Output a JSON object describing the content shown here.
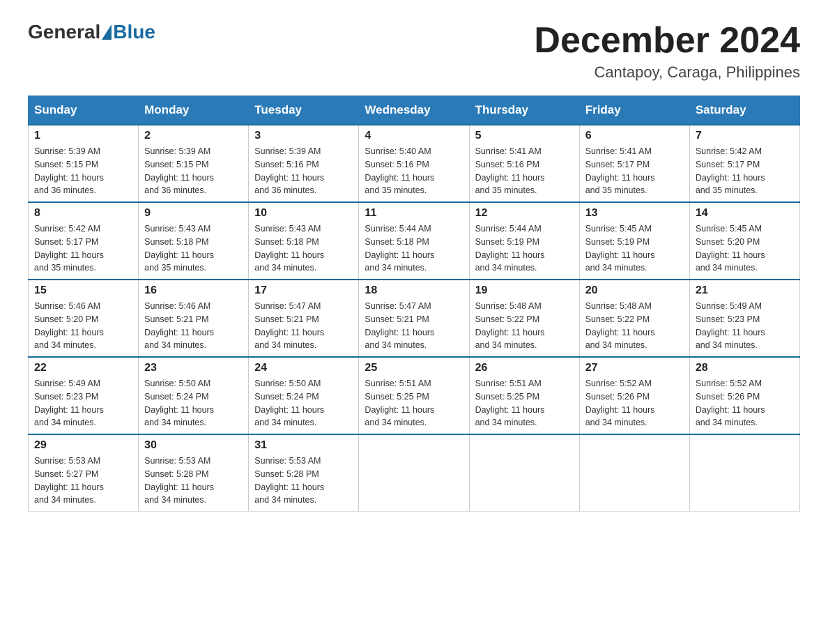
{
  "logo": {
    "general": "General",
    "blue": "Blue"
  },
  "title": "December 2024",
  "location": "Cantapoy, Caraga, Philippines",
  "headers": [
    "Sunday",
    "Monday",
    "Tuesday",
    "Wednesday",
    "Thursday",
    "Friday",
    "Saturday"
  ],
  "weeks": [
    [
      {
        "day": "1",
        "sunrise": "5:39 AM",
        "sunset": "5:15 PM",
        "daylight": "11 hours and 36 minutes."
      },
      {
        "day": "2",
        "sunrise": "5:39 AM",
        "sunset": "5:15 PM",
        "daylight": "11 hours and 36 minutes."
      },
      {
        "day": "3",
        "sunrise": "5:39 AM",
        "sunset": "5:16 PM",
        "daylight": "11 hours and 36 minutes."
      },
      {
        "day": "4",
        "sunrise": "5:40 AM",
        "sunset": "5:16 PM",
        "daylight": "11 hours and 35 minutes."
      },
      {
        "day": "5",
        "sunrise": "5:41 AM",
        "sunset": "5:16 PM",
        "daylight": "11 hours and 35 minutes."
      },
      {
        "day": "6",
        "sunrise": "5:41 AM",
        "sunset": "5:17 PM",
        "daylight": "11 hours and 35 minutes."
      },
      {
        "day": "7",
        "sunrise": "5:42 AM",
        "sunset": "5:17 PM",
        "daylight": "11 hours and 35 minutes."
      }
    ],
    [
      {
        "day": "8",
        "sunrise": "5:42 AM",
        "sunset": "5:17 PM",
        "daylight": "11 hours and 35 minutes."
      },
      {
        "day": "9",
        "sunrise": "5:43 AM",
        "sunset": "5:18 PM",
        "daylight": "11 hours and 35 minutes."
      },
      {
        "day": "10",
        "sunrise": "5:43 AM",
        "sunset": "5:18 PM",
        "daylight": "11 hours and 34 minutes."
      },
      {
        "day": "11",
        "sunrise": "5:44 AM",
        "sunset": "5:18 PM",
        "daylight": "11 hours and 34 minutes."
      },
      {
        "day": "12",
        "sunrise": "5:44 AM",
        "sunset": "5:19 PM",
        "daylight": "11 hours and 34 minutes."
      },
      {
        "day": "13",
        "sunrise": "5:45 AM",
        "sunset": "5:19 PM",
        "daylight": "11 hours and 34 minutes."
      },
      {
        "day": "14",
        "sunrise": "5:45 AM",
        "sunset": "5:20 PM",
        "daylight": "11 hours and 34 minutes."
      }
    ],
    [
      {
        "day": "15",
        "sunrise": "5:46 AM",
        "sunset": "5:20 PM",
        "daylight": "11 hours and 34 minutes."
      },
      {
        "day": "16",
        "sunrise": "5:46 AM",
        "sunset": "5:21 PM",
        "daylight": "11 hours and 34 minutes."
      },
      {
        "day": "17",
        "sunrise": "5:47 AM",
        "sunset": "5:21 PM",
        "daylight": "11 hours and 34 minutes."
      },
      {
        "day": "18",
        "sunrise": "5:47 AM",
        "sunset": "5:21 PM",
        "daylight": "11 hours and 34 minutes."
      },
      {
        "day": "19",
        "sunrise": "5:48 AM",
        "sunset": "5:22 PM",
        "daylight": "11 hours and 34 minutes."
      },
      {
        "day": "20",
        "sunrise": "5:48 AM",
        "sunset": "5:22 PM",
        "daylight": "11 hours and 34 minutes."
      },
      {
        "day": "21",
        "sunrise": "5:49 AM",
        "sunset": "5:23 PM",
        "daylight": "11 hours and 34 minutes."
      }
    ],
    [
      {
        "day": "22",
        "sunrise": "5:49 AM",
        "sunset": "5:23 PM",
        "daylight": "11 hours and 34 minutes."
      },
      {
        "day": "23",
        "sunrise": "5:50 AM",
        "sunset": "5:24 PM",
        "daylight": "11 hours and 34 minutes."
      },
      {
        "day": "24",
        "sunrise": "5:50 AM",
        "sunset": "5:24 PM",
        "daylight": "11 hours and 34 minutes."
      },
      {
        "day": "25",
        "sunrise": "5:51 AM",
        "sunset": "5:25 PM",
        "daylight": "11 hours and 34 minutes."
      },
      {
        "day": "26",
        "sunrise": "5:51 AM",
        "sunset": "5:25 PM",
        "daylight": "11 hours and 34 minutes."
      },
      {
        "day": "27",
        "sunrise": "5:52 AM",
        "sunset": "5:26 PM",
        "daylight": "11 hours and 34 minutes."
      },
      {
        "day": "28",
        "sunrise": "5:52 AM",
        "sunset": "5:26 PM",
        "daylight": "11 hours and 34 minutes."
      }
    ],
    [
      {
        "day": "29",
        "sunrise": "5:53 AM",
        "sunset": "5:27 PM",
        "daylight": "11 hours and 34 minutes."
      },
      {
        "day": "30",
        "sunrise": "5:53 AM",
        "sunset": "5:28 PM",
        "daylight": "11 hours and 34 minutes."
      },
      {
        "day": "31",
        "sunrise": "5:53 AM",
        "sunset": "5:28 PM",
        "daylight": "11 hours and 34 minutes."
      },
      null,
      null,
      null,
      null
    ]
  ],
  "labels": {
    "sunrise": "Sunrise:",
    "sunset": "Sunset:",
    "daylight": "Daylight:"
  }
}
